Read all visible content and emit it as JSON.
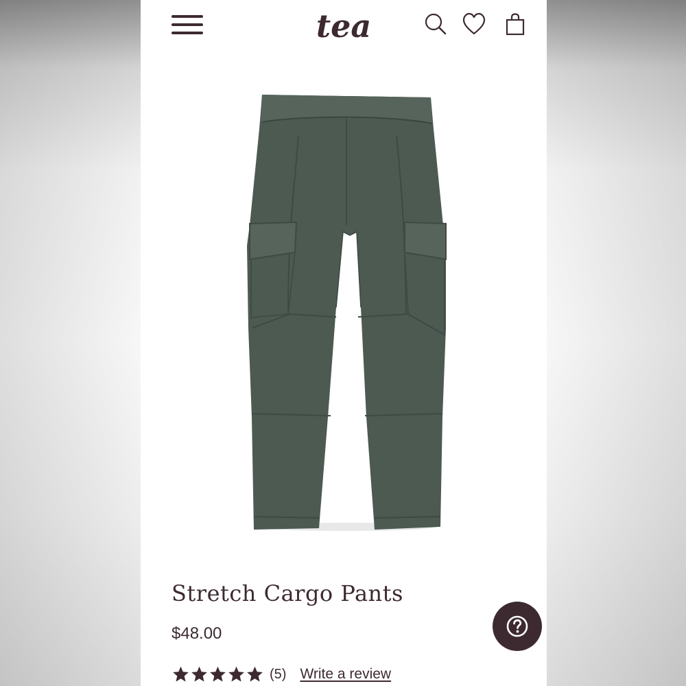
{
  "header": {
    "logo_text": "tea",
    "menu_icon": "hamburger-menu-icon",
    "search_icon": "search-icon",
    "wishlist_icon": "heart-icon",
    "cart_icon": "shopping-bag-icon"
  },
  "product": {
    "name": "Stretch Cargo Pants",
    "price": "$48.00",
    "rating": 5,
    "rating_max": 5,
    "review_count": "(5)",
    "write_review_label": "Write a review",
    "image_color": "#4c5a52"
  },
  "help": {
    "icon": "question-mark-icon"
  },
  "colors": {
    "brand": "#3d2a31",
    "background": "#ffffff"
  }
}
